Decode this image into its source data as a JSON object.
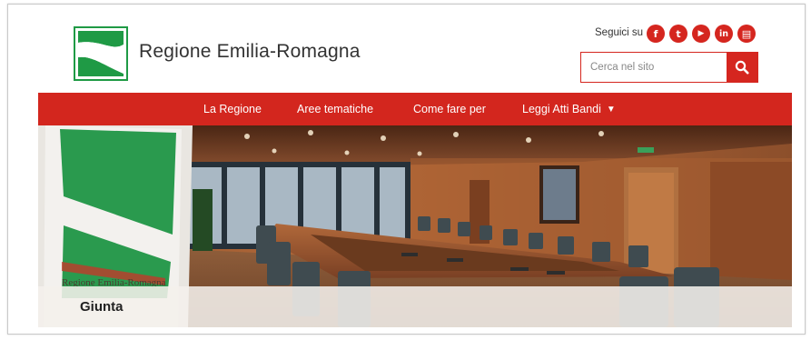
{
  "header": {
    "site_name": "Regione Emilia-Romagna",
    "follow_label": "Seguici su",
    "socials": [
      {
        "icon": "facebook-icon",
        "glyph": "f"
      },
      {
        "icon": "twitter-icon",
        "glyph": "t"
      },
      {
        "icon": "youtube-icon",
        "glyph": "▶"
      },
      {
        "icon": "linkedin-icon",
        "glyph": "in"
      },
      {
        "icon": "newsletter-icon",
        "glyph": "▤"
      }
    ],
    "search": {
      "placeholder": "Cerca nel sito",
      "icon": "search-icon"
    }
  },
  "nav": {
    "items": [
      "La Regione",
      "Aree tematiche",
      "Come fare per",
      "Leggi Atti Bandi"
    ],
    "dropdown_icon": "chevron-down-icon"
  },
  "hero": {
    "caption": "Giunta",
    "flag_text": "Regione Emilia-Romagna"
  },
  "colors": {
    "accent": "#d3261e",
    "brand_green": "#1f9a45"
  }
}
